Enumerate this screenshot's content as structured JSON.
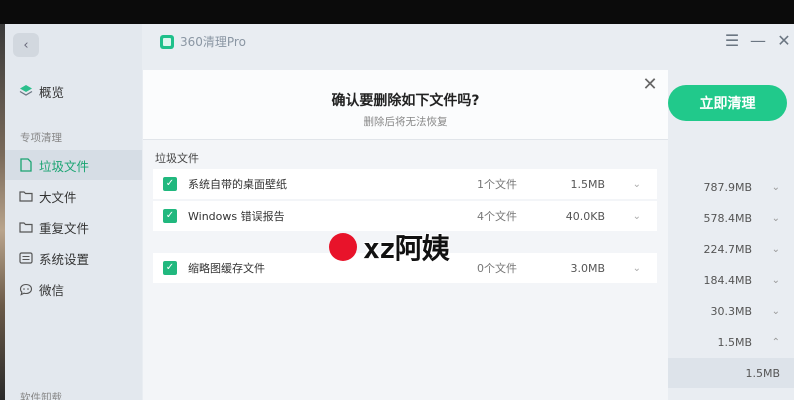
{
  "titlebar": {
    "app_title": "360清理Pro",
    "icons": {
      "menu": "menu-icon",
      "minimize": "minimize-icon",
      "close": "close-icon"
    },
    "menu_glyph": "☰",
    "minimize_glyph": "—",
    "close_glyph": "✕"
  },
  "sidebar": {
    "back_glyph": "‹",
    "overview_label": "概览",
    "section_label": "专项清理",
    "items": [
      {
        "label": "垃圾文件",
        "icon": "file-icon"
      },
      {
        "label": "大文件",
        "icon": "folder-icon"
      },
      {
        "label": "重复文件",
        "icon": "folder-icon"
      },
      {
        "label": "系统设置",
        "icon": "settings-panel-icon"
      },
      {
        "label": "微信",
        "icon": "chat-bubble-icon"
      }
    ],
    "bottom_label": "软件卸载"
  },
  "main": {
    "clean_button_label": "立即清理",
    "sizes": [
      {
        "size": "787.9MB",
        "chevron": "⌄"
      },
      {
        "size": "578.4MB",
        "chevron": "⌄"
      },
      {
        "size": "224.7MB",
        "chevron": "⌄"
      },
      {
        "size": "184.4MB",
        "chevron": "⌄"
      },
      {
        "size": "30.3MB",
        "chevron": "⌄"
      },
      {
        "size": "1.5MB",
        "chevron": "⌃"
      },
      {
        "size": "1.5MB",
        "chevron": ""
      }
    ]
  },
  "dialog": {
    "title": "确认要删除如下文件吗?",
    "subtitle": "删除后将无法恢复",
    "close_glyph": "✕",
    "group_label": "垃圾文件",
    "files": [
      {
        "name": "系统自带的桌面壁纸",
        "count": "1个文件",
        "size": "1.5MB",
        "checked": true
      },
      {
        "name": "Windows 错误报告",
        "count": "4个文件",
        "size": "40.0KB",
        "checked": true
      },
      {
        "name": "缩略图缓存文件",
        "count": "0个文件",
        "size": "3.0MB",
        "checked": true
      }
    ],
    "check_glyph": "✓",
    "row_chevron": "⌄"
  },
  "watermark": {
    "text": "xz阿姨"
  },
  "colors": {
    "accent": "#21c98b",
    "checkbox": "#21b87e",
    "watermark_dot": "#e8132a"
  }
}
